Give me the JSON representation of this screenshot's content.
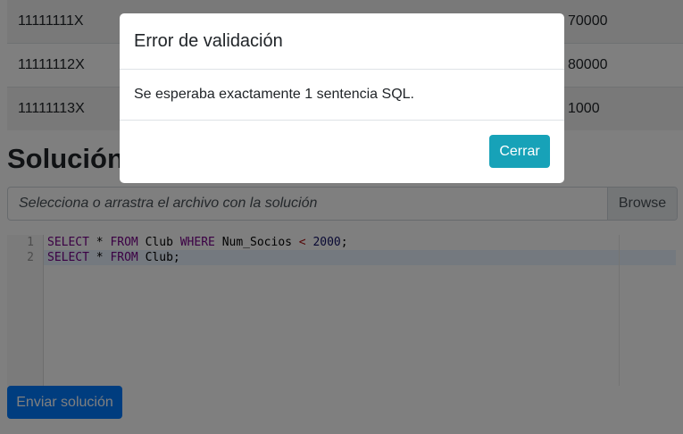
{
  "table": {
    "rows": [
      {
        "id": "11111111X",
        "value": "70000"
      },
      {
        "id": "11111112X",
        "value": "80000"
      },
      {
        "id": "11111113X",
        "value": "1000"
      }
    ]
  },
  "solution": {
    "heading": "Solución",
    "file_placeholder": "Selecciona o arrastra el archivo con la solución",
    "browse_label": "Browse",
    "submit_label": "Enviar solución"
  },
  "editor": {
    "line_numbers": [
      "1",
      "2"
    ],
    "lines": [
      [
        "SELECT",
        " * ",
        "FROM",
        " Club ",
        "WHERE",
        " Num_Socios ",
        "<",
        " ",
        "2000",
        ";"
      ],
      [
        "SELECT",
        " * ",
        "FROM",
        " Club;"
      ]
    ]
  },
  "modal": {
    "title": "Error de validación",
    "message": "Se esperaba exactamente 1 sentencia SQL.",
    "close_label": "Cerrar"
  }
}
